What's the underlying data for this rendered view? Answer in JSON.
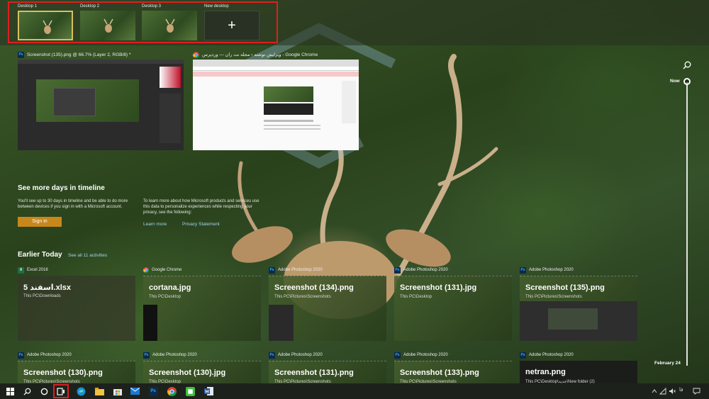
{
  "desktops": [
    {
      "label": "Desktop 1",
      "active": true
    },
    {
      "label": "Desktop 2",
      "active": false
    },
    {
      "label": "Desktop 3",
      "active": false
    }
  ],
  "new_desktop": {
    "label": "New desktop",
    "symbol": "+"
  },
  "windows": [
    {
      "title": "Screenshot (135).png @ 66.7% (Layer 2, RGB/8) *",
      "app_icon": "photoshop-icon",
      "app_glyph": "Ps"
    },
    {
      "title": "ویرایش نوشته › مجله نت ران — وردپرس - Google Chrome",
      "app_icon": "chrome-icon"
    }
  ],
  "timeline": {
    "now_label": "Now",
    "date_label": "February 24"
  },
  "see_more": {
    "title": "See more days in timeline",
    "text": "You'll see up to 30 days in timeline and be able to do more between devices if you sign in with a Microsoft account.",
    "signin_label": "Sign in",
    "privacy_text": "To learn more about how Microsoft products and services use this data to personalize experiences while respecting your privacy, see the following:",
    "learn_more": "Learn more",
    "privacy_statement": "Privacy Statement"
  },
  "earlier_today": {
    "title": "Earlier Today",
    "see_all": "See all 11 activities"
  },
  "cards": [
    {
      "app": "Excel 2016",
      "icon": "excel-icon",
      "glyph": "X",
      "title": "5 اسفند.xlsx",
      "path": "This PC\\Downloads",
      "style": "plain"
    },
    {
      "app": "Google Chrome",
      "icon": "chrome-icon",
      "glyph": "",
      "title": "cortana.jpg",
      "path": "This PC\\Desktop",
      "style": "photo"
    },
    {
      "app": "Adobe Photoshop 2020",
      "icon": "photoshop-icon",
      "glyph": "Ps",
      "title": "Screenshot (134).png",
      "path": "This PC\\Pictures\\Screenshots",
      "style": "photo"
    },
    {
      "app": "Adobe Photoshop 2020",
      "icon": "photoshop-icon",
      "glyph": "Ps",
      "title": "Screenshot (131).jpg",
      "path": "This PC\\Desktop",
      "style": "photo"
    },
    {
      "app": "Adobe Photoshop 2020",
      "icon": "photoshop-icon",
      "glyph": "Ps",
      "title": "Screenshot (135).png",
      "path": "This PC\\Pictures\\Screenshots",
      "style": "photo"
    },
    {
      "app": "Adobe Photoshop 2020",
      "icon": "photoshop-icon",
      "glyph": "Ps",
      "title": "Screenshot (130).png",
      "path": "This PC\\Pictures\\Screenshots",
      "style": "photo"
    },
    {
      "app": "Adobe Photoshop 2020",
      "icon": "photoshop-icon",
      "glyph": "Ps",
      "title": "Screenshot (130).jpg",
      "path": "This PC\\Desktop",
      "style": "photo"
    },
    {
      "app": "Adobe Photoshop 2020",
      "icon": "photoshop-icon",
      "glyph": "Ps",
      "title": "Screenshot (131).png",
      "path": "This PC\\Pictures\\Screenshots",
      "style": "photo"
    },
    {
      "app": "Adobe Photoshop 2020",
      "icon": "photoshop-icon",
      "glyph": "Ps",
      "title": "Screenshot (133).png",
      "path": "This PC\\Pictures\\Screenshots",
      "style": "photo"
    },
    {
      "app": "Adobe Photoshop 2020",
      "icon": "photoshop-icon",
      "glyph": "Ps",
      "title": "netran.png",
      "path": "This PC\\Desktop\\جدید\\New folder (2)",
      "style": "dark"
    }
  ],
  "taskbar": {
    "icons": [
      "start-icon",
      "search-icon",
      "cortana-icon",
      "task-view-icon",
      "edge-icon",
      "file-explorer-icon",
      "store-icon",
      "mail-icon",
      "photoshop-icon",
      "chrome-icon",
      "camtasia-icon",
      "word-icon"
    ],
    "tray_language": "فا"
  },
  "colors": {
    "accent_red": "#e01e1e",
    "signin": "#c8871a",
    "link": "#9fd4f0",
    "taskbar": "#1d211b"
  }
}
